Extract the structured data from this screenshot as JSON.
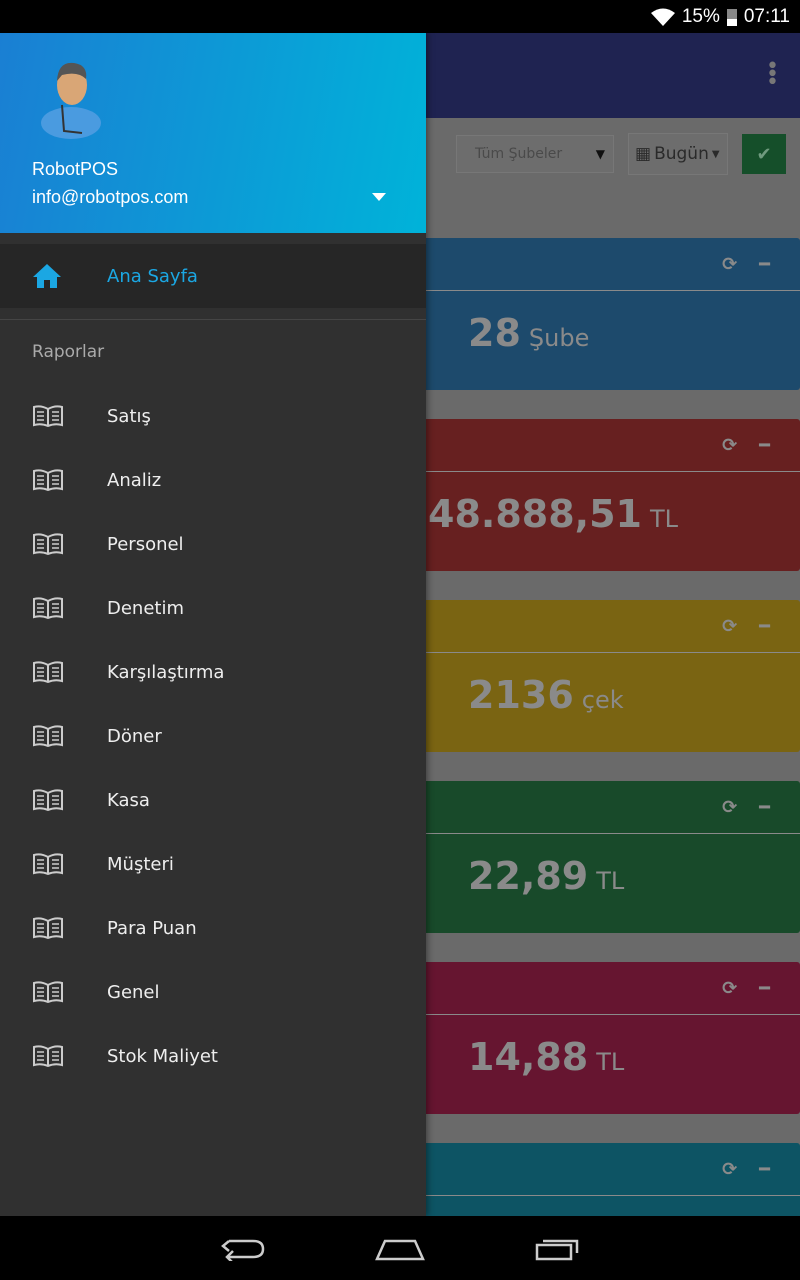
{
  "status_bar": {
    "battery": "15%",
    "time": "07:11"
  },
  "toolbar": {
    "branch_select": "Tüm Şubeler",
    "date_button": "Bugün"
  },
  "cards": [
    {
      "value": "28",
      "unit": "Şube",
      "color": "#1d4a6c"
    },
    {
      "value": "48.888,51",
      "unit": "TL",
      "color": "#672020"
    },
    {
      "value": "2136",
      "unit": "çek",
      "color": "#7a6412"
    },
    {
      "value": "22,89",
      "unit": "TL",
      "color": "#184a2a"
    },
    {
      "value": "14,88",
      "unit": "TL",
      "color": "#661530"
    },
    {
      "value": "",
      "unit": "",
      "color": "#0d5464"
    }
  ],
  "drawer": {
    "user_name": "RobotPOS",
    "user_email": "info@robotpos.com",
    "home": "Ana Sayfa",
    "section": "Raporlar",
    "items": [
      "Satış",
      "Analiz",
      "Personel",
      "Denetim",
      "Karşılaştırma",
      "Döner",
      "Kasa",
      "Müşteri",
      "Para Puan",
      "Genel",
      "Stok Maliyet"
    ],
    "accent": "#1ba7e3"
  }
}
